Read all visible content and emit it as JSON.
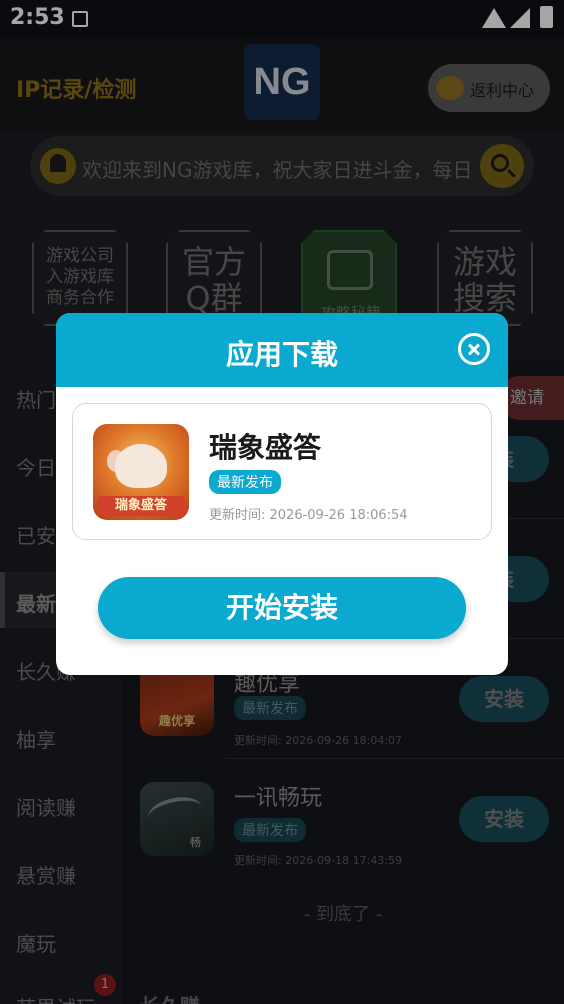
{
  "status_bar": {
    "time": "2:53",
    "icons": [
      "notification-a-icon",
      "wifi-icon",
      "signal-icon",
      "battery-charging-icon"
    ]
  },
  "header": {
    "left_title": "IP记录/检测",
    "logo_text": "NG",
    "rebate_label": "返利中心"
  },
  "notice": {
    "text": "欢迎来到NG游戏库，祝大家日进斗金，每日",
    "icons": [
      "bell-icon",
      "search-icon"
    ]
  },
  "tiles": [
    {
      "label": "游戏公司\n入游戏库\n商务合作"
    },
    {
      "label": "官方\nQ群"
    },
    {
      "label": "攻略秘籍"
    },
    {
      "label": "游戏\n搜索"
    }
  ],
  "sidebar": {
    "items": [
      "热门",
      "今日",
      "已安",
      "最新",
      "长久赚",
      "柚享",
      "阅读赚",
      "悬赏赚",
      "魔玩",
      "苹果试玩"
    ],
    "active_index": 3,
    "badge_count": "1"
  },
  "list": {
    "invite_label": "邀请",
    "install_label": "安装",
    "install_partial": "装",
    "apps": [
      {
        "name": "趣优享",
        "badge": "最新发布",
        "time": "更新时间: 2026-09-26 18:04:07",
        "icon_label": "趣优享"
      },
      {
        "name": "一讯畅玩",
        "badge": "最新发布",
        "time": "更新时间: 2026-09-18 17:43:59",
        "icon_label": "畅"
      }
    ],
    "end_text": "- 到底了 -",
    "bottom_partial": "长久赚"
  },
  "dialog": {
    "title": "应用下载",
    "app_name": "瑞象盛答",
    "badge": "最新发布",
    "update_time": "更新时间: 2026-09-26 18:06:54",
    "icon_label": "瑞象盛答",
    "start_label": "开始安装"
  },
  "colors": {
    "accent": "#0aa9cf",
    "gold": "#8a6d16",
    "badge_red": "#8e1c1c"
  }
}
